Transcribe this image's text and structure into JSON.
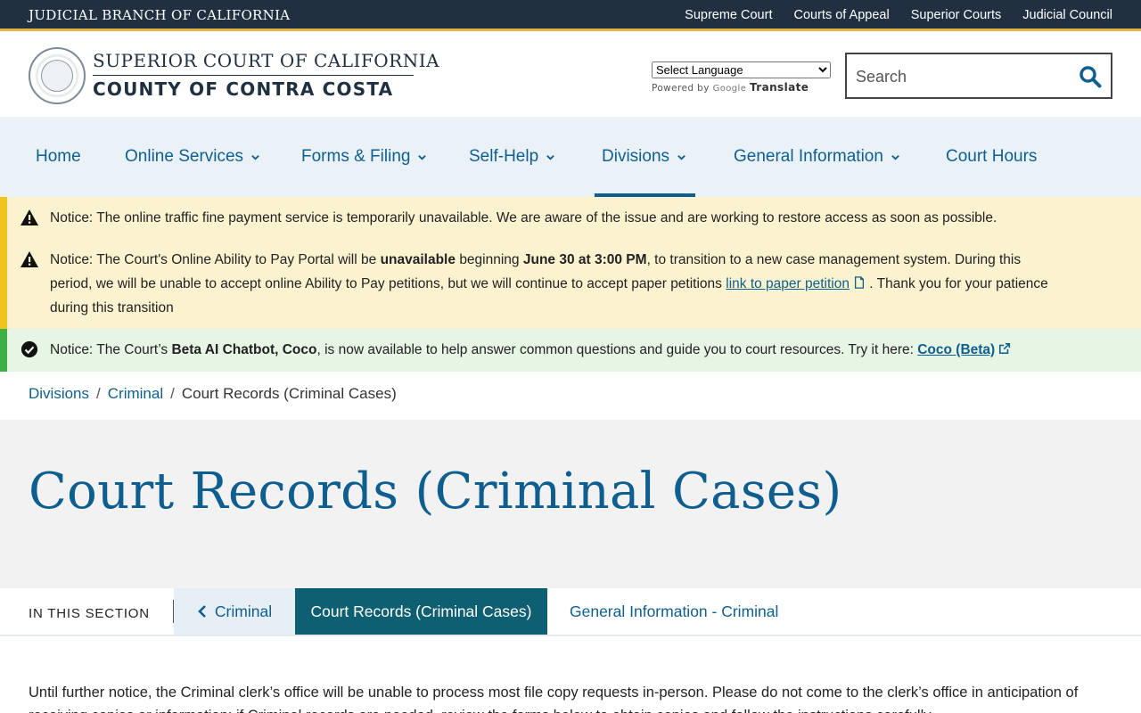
{
  "topbar": {
    "brand": "JUDICIAL BRANCH OF CALIFORNIA",
    "links": [
      "Supreme Court",
      "Courts of Appeal",
      "Superior Courts",
      "Judicial Council"
    ]
  },
  "header": {
    "logo_line1": "SUPERIOR COURT OF CALIFORNIA",
    "logo_line2": "COUNTY OF CONTRA COSTA",
    "language_select": "Select Language",
    "powered_by": "Powered by",
    "google_logo": "Google",
    "translate": "Translate",
    "search_placeholder": "Search"
  },
  "nav": {
    "items": [
      "Home",
      "Online Services",
      "Forms & Filing",
      "Self-Help",
      "Divisions",
      "General Information",
      "Court Hours"
    ],
    "active": "Divisions"
  },
  "notices": {
    "n1": {
      "label": "Notice:",
      "text": "The online traffic fine payment service is temporarily unavailable. We are aware of the issue and are working to restore access as soon as possible."
    },
    "n2": {
      "label": "Notice:",
      "t1": "The Court's Online Ability to Pay Portal will be",
      "b1": "unavailable",
      "t2": "beginning",
      "b2": "June 30 at 3:00 PM",
      "t3": ", to transition to a new case management system. During this period, we will be unable to accept online Ability to Pay petitions, but we will continue to accept paper petitions",
      "link": "link to paper petition",
      "t4": ". Thank you for your patience during this transition"
    },
    "n3": {
      "label": "Notice:",
      "t1": "The Court’s",
      "b1": "Beta AI Chatbot, Coco",
      "t2": ", is now available to help answer common questions and guide you to court resources. Try it here:",
      "link": "Coco (Beta)"
    }
  },
  "breadcrumb": [
    "Divisions",
    "Criminal",
    "Court Records (Criminal Cases)"
  ],
  "page_title": "Court Records (Criminal Cases)",
  "section_nav": {
    "label": "IN THIS SECTION",
    "back": "Criminal",
    "current": "Court Records (Criminal Cases)",
    "other": "General Information - Criminal"
  },
  "body": {
    "para1": "Until further notice, the Criminal clerk’s office will be unable to process most file copy requests in-person. Please do not come to the clerk’s office in anticipation of receiving copies or information; if Criminal records are needed, review the forms below to obtain copies and follow the instructions carefully."
  },
  "colors": {
    "topbar": "#203040",
    "accent": "#e3b23c",
    "link": "#0e5f8f",
    "nav_bg": "#eaf2f8",
    "notice_warn_bg": "#fbf3cf",
    "notice_ok_bg": "#e6f5e4",
    "current_tab": "#0e5f72"
  },
  "icons": [
    "search-icon",
    "chevron-down-icon",
    "warning-icon",
    "check-circle-icon",
    "document-icon",
    "external-link-icon",
    "chevron-left-icon"
  ]
}
